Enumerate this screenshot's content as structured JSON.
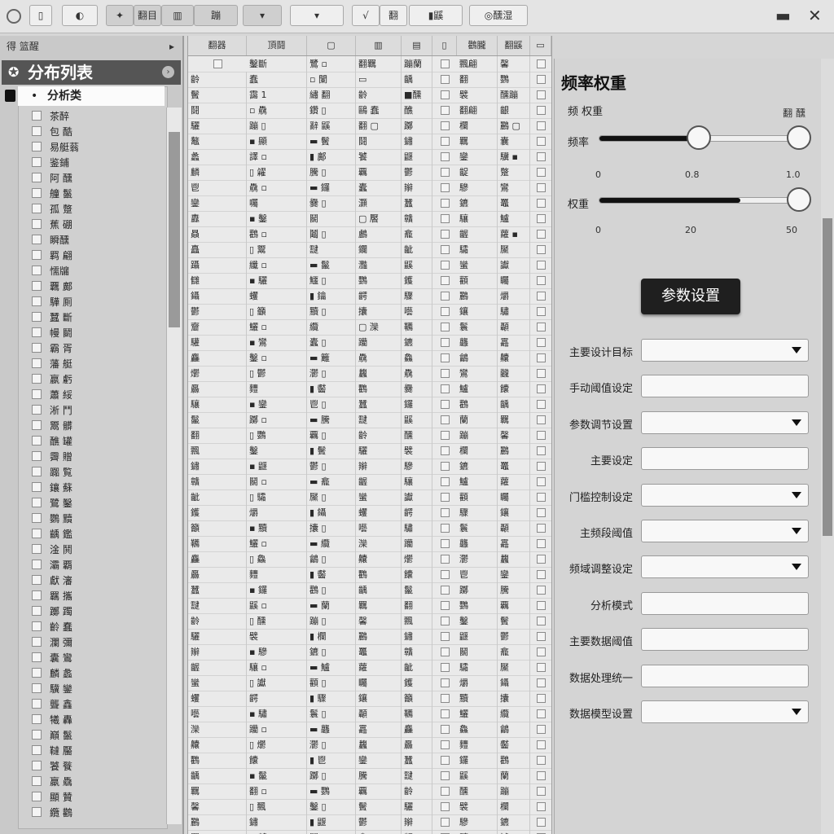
{
  "toolbar": {
    "btn_1": "▯",
    "btn_2": "◐",
    "btn_3": "✦",
    "btn_4": "翻目",
    "btn_5": "▥",
    "btn_6": "蹦",
    "btn_7": "▾",
    "btn_8": "√",
    "btn_9": "翻",
    "btn_10": "▮鼷",
    "btn_11": "◎醺湿",
    "minimize": "▬",
    "close": "✕"
  },
  "sidebar": {
    "top_label": "得 篮醒",
    "top_icon": "▸",
    "header_logo": "✪",
    "header_title": "分布列表",
    "header_chevron": "›",
    "selected_bullet": "•",
    "selected_label": "分析类",
    "items": [
      "茶醉",
      "包 酷",
      "易艇蓊",
      "鉴鋪",
      "阿 醺",
      "艟 鬣",
      "孤 蹩",
      "蕉 硼",
      "瞬醺",
      "羁 翩",
      "懦牖",
      "覊 鄺",
      "驊 厠",
      "蠶 斷",
      "幔 鬭",
      "霸 胥",
      "藩 艇",
      "嬴 虧",
      "蕭 綏",
      "淅 鬥",
      "鬻 髒",
      "醮 罐",
      "霽 贈",
      "嚻 覧",
      "鑲 蘇",
      "鷺 鑿",
      "鸚 黷",
      "齲 鑑",
      "淦 鬨",
      "灞 覇",
      "獻 瀋",
      "羈 攜",
      "躑 躅",
      "齡 蠢",
      "瀾 彌",
      "囊 鸞",
      "麟 蠡",
      "驥 鑾",
      "聾 鑫",
      "犧 轟",
      "巔 鬣",
      "韃 靨",
      "饕 餮",
      "羸 驫",
      "顯 贊",
      "纜 鸛"
    ]
  },
  "grid": {
    "headers": [
      "翻器",
      "頂鬪",
      "▢",
      "▥",
      "▤",
      "▯",
      "鸛朧",
      "翻鼷",
      "▭"
    ],
    "rows": [
      [
        "▢",
        "鑿斷",
        "鷺 ▫",
        "翻羈",
        "蹦蘭",
        "▢",
        "飄翩",
        "馨",
        "▢"
      ],
      [
        "齡",
        "蠢",
        "▫ 闌",
        "▭",
        "齲",
        "▢",
        "翻",
        "鸚",
        "▢"
      ],
      [
        "鬢",
        "靄 1",
        "繡 翻",
        "齡",
        "■醺",
        "▢",
        "襞",
        "醺蹦",
        "▢"
      ],
      [
        "鬪",
        "▫ 驫",
        "鑽 ▯",
        "鷗 蠢",
        "醮",
        "▢",
        "翻翩",
        "齦",
        "▢"
      ],
      [
        "驪",
        "蹦 ▯",
        "辭 鼷",
        "翻 ▢",
        "躑",
        "▢",
        "欄",
        "鸝 ▢",
        "▢"
      ],
      [
        "鼇",
        "▪ 顯",
        "▬ 鬢",
        "鬪",
        "鏽",
        "▢",
        "羈",
        "囊",
        "▢"
      ],
      [
        "蠡",
        "譯 ▫",
        "▮ 鄺",
        "饕",
        "鼴",
        "▢",
        "鑾",
        "驥 ▪",
        "▢"
      ],
      [
        "麟",
        "▯ 糴",
        "騰 ▯",
        "覊",
        "鬱",
        "▢",
        "齪",
        "蹩",
        "▢"
      ],
      [
        "鬯",
        "驫 ▫",
        "▬ 鑼",
        "蠹",
        "辮",
        "▢",
        "驂",
        "鸞",
        "▢"
      ],
      [
        "鑾",
        "囑",
        "爨 ▯",
        "灝",
        "蠶",
        "▢",
        "鑣",
        "鼉",
        "▢"
      ],
      [
        "纛",
        "▪ 鑿",
        "鬭",
        "▢ 饜",
        "贛",
        "▢",
        "驤",
        "鱸",
        "▢"
      ],
      [
        "贔",
        "鸛 ▫",
        "鬮 ▯",
        "鸕",
        "龕",
        "▢",
        "齷",
        "蘿 ▪",
        "▢"
      ],
      [
        "矗",
        "▯ 鬻",
        "靆",
        "鑭",
        "齜",
        "▢",
        "驦",
        "黶",
        "▢"
      ],
      [
        "躡",
        "纖 ▫",
        "▬ 鬣",
        "灩",
        "鼷",
        "▢",
        "蠻",
        "讞",
        "▢"
      ],
      [
        "讎",
        "▪ 驪",
        "鱷 ▯",
        "鸚",
        "鑊",
        "▢",
        "顴",
        "矚",
        "▢"
      ],
      [
        "鑷",
        "蠼",
        "▮ 鑰",
        "齶",
        "驟",
        "▢",
        "鸝",
        "爝",
        "▢"
      ],
      [
        "鬱",
        "▯ 籲",
        "黷 ▯",
        "攮",
        "囈",
        "▢",
        "鑲",
        "驌",
        "▢"
      ],
      [
        "齏",
        "鱺 ▫",
        "纜",
        "▢ 灤",
        "韉",
        "▢",
        "鬟",
        "顳",
        "▢"
      ],
      [
        "驩",
        "▪ 鸞",
        "蠹 ▯",
        "躪",
        "鑣",
        "▢",
        "龘",
        "靐",
        "▢"
      ],
      [
        "麤",
        "鑿 ▫",
        "▬ 籬",
        "驫",
        "鱻",
        "▢",
        "鸙",
        "齉",
        "▢"
      ],
      [
        "爩",
        "▯ 鬱",
        "灪 ▯",
        "蠿",
        "驫",
        "▢",
        "鸞",
        "龖",
        "▢"
      ],
      [
        "厵",
        "麷",
        "▮ 齾",
        "鸜",
        "爨",
        "▢",
        "鱸",
        "饢",
        "▢"
      ],
      [
        "驤",
        "▪ 鑾",
        "鬯 ▯",
        "蠶",
        "鑼",
        "▢",
        "鸛",
        "齲",
        "▢"
      ],
      [
        "鬣",
        "躑 ▫",
        "▬ 騰",
        "靆",
        "鼷",
        "▢",
        "蘭",
        "羈",
        "▢"
      ],
      [
        "翻",
        "▯ 鸚",
        "覊 ▯",
        "齡",
        "醺",
        "▢",
        "蹦",
        "馨",
        "▢"
      ],
      [
        "飄",
        "鑿",
        "▮ 鬢",
        "驪",
        "襞",
        "▢",
        "欄",
        "鸝",
        "▢"
      ],
      [
        "鏽",
        "▪ 鼴",
        "鬱 ▯",
        "辮",
        "驂",
        "▢",
        "鑣",
        "鼉",
        "▢"
      ],
      [
        "贛",
        "鬭 ▫",
        "▬ 龕",
        "齷",
        "驤",
        "▢",
        "鱸",
        "蘿",
        "▢"
      ],
      [
        "齜",
        "▯ 驦",
        "黶 ▯",
        "蠻",
        "讞",
        "▢",
        "顴",
        "矚",
        "▢"
      ],
      [
        "鑊",
        "爝",
        "▮ 鑷",
        "蠼",
        "齶",
        "▢",
        "驟",
        "鑲",
        "▢"
      ],
      [
        "籲",
        "▪ 黷",
        "攮 ▯",
        "囈",
        "驌",
        "▢",
        "鬟",
        "顳",
        "▢"
      ],
      [
        "韉",
        "鱺 ▫",
        "▬ 纜",
        "灤",
        "躪",
        "▢",
        "龘",
        "靐",
        "▢"
      ],
      [
        "麤",
        "▯ 鱻",
        "鸙 ▯",
        "齉",
        "爩",
        "▢",
        "灪",
        "蠿",
        "▢"
      ],
      [
        "厵",
        "麷",
        "▮ 齾",
        "鸜",
        "饢",
        "▢",
        "鬯",
        "鑾",
        "▢"
      ],
      [
        "蠶",
        "▪ 鑼",
        "鸛 ▯",
        "齲",
        "鬣",
        "▢",
        "躑",
        "騰",
        "▢"
      ],
      [
        "靆",
        "鼷 ▫",
        "▬ 蘭",
        "羈",
        "翻",
        "▢",
        "鸚",
        "覊",
        "▢"
      ],
      [
        "齡",
        "▯ 醺",
        "蹦 ▯",
        "馨",
        "飄",
        "▢",
        "鑿",
        "鬢",
        "▢"
      ],
      [
        "驪",
        "襞",
        "▮ 欄",
        "鸝",
        "鏽",
        "▢",
        "鼴",
        "鬱",
        "▢"
      ],
      [
        "辮",
        "▪ 驂",
        "鑣 ▯",
        "鼉",
        "贛",
        "▢",
        "鬭",
        "龕",
        "▢"
      ],
      [
        "齷",
        "驤 ▫",
        "▬ 鱸",
        "蘿",
        "齜",
        "▢",
        "驦",
        "黶",
        "▢"
      ],
      [
        "蠻",
        "▯ 讞",
        "顴 ▯",
        "矚",
        "鑊",
        "▢",
        "爝",
        "鑷",
        "▢"
      ],
      [
        "蠼",
        "齶",
        "▮ 驟",
        "鑲",
        "籲",
        "▢",
        "黷",
        "攮",
        "▢"
      ],
      [
        "囈",
        "▪ 驌",
        "鬟 ▯",
        "顳",
        "韉",
        "▢",
        "鱺",
        "纜",
        "▢"
      ],
      [
        "灤",
        "躪 ▫",
        "▬ 龘",
        "靐",
        "麤",
        "▢",
        "鱻",
        "鸙",
        "▢"
      ],
      [
        "齉",
        "▯ 爩",
        "灪 ▯",
        "蠿",
        "厵",
        "▢",
        "麷",
        "齾",
        "▢"
      ],
      [
        "鸜",
        "饢",
        "▮ 鬯",
        "鑾",
        "蠶",
        "▢",
        "鑼",
        "鸛",
        "▢"
      ],
      [
        "齲",
        "▪ 鬣",
        "躑 ▯",
        "騰",
        "靆",
        "▢",
        "鼷",
        "蘭",
        "▢"
      ],
      [
        "羈",
        "翻 ▫",
        "▬ 鸚",
        "覊",
        "齡",
        "▢",
        "醺",
        "蹦",
        "▢"
      ],
      [
        "馨",
        "▯ 飄",
        "鑿 ▯",
        "鬢",
        "驪",
        "▢",
        "襞",
        "欄",
        "▢"
      ],
      [
        "鸝",
        "鏽",
        "▮ 鼴",
        "鬱",
        "辮",
        "▢",
        "驂",
        "鑣",
        "▢"
      ],
      [
        "鼉",
        "▪ 贛",
        "鬭 ▯",
        "龕",
        "齷",
        "▢",
        "驤",
        "鱸",
        "▢"
      ]
    ]
  },
  "panel": {
    "title": "频率权重",
    "subtitle_left": "频 权重",
    "subtitle_right": "翻 醺",
    "slider1": {
      "label": "频率",
      "ticks": [
        "0",
        "0.8",
        "1.0"
      ],
      "fill_fraction": 0.48,
      "second_knob_fraction": 0.96
    },
    "slider2": {
      "label": "权重",
      "ticks": [
        "0",
        "20",
        "50"
      ],
      "fill_fraction": 0.68,
      "knob_fraction": 0.96
    },
    "set_button": "参数设置",
    "fields": [
      {
        "label": "主要设计目标",
        "type": "select",
        "value": ""
      },
      {
        "label": "手动阈值设定",
        "type": "text",
        "value": ""
      },
      {
        "label": "参数调节设置",
        "type": "select",
        "value": ""
      },
      {
        "label": "主要设定",
        "type": "text",
        "value": ""
      },
      {
        "label": "门槛控制设定",
        "type": "select",
        "value": ""
      },
      {
        "label": "主频段阈值",
        "type": "select",
        "value": ""
      },
      {
        "label": "频域调整设定",
        "type": "select",
        "value": ""
      },
      {
        "label": "分析模式",
        "type": "text",
        "value": ""
      },
      {
        "label": "主要数据阈值",
        "type": "text",
        "value": ""
      },
      {
        "label": "数据处理统一",
        "type": "text",
        "value": ""
      },
      {
        "label": "数据模型设置",
        "type": "select",
        "value": ""
      }
    ]
  }
}
